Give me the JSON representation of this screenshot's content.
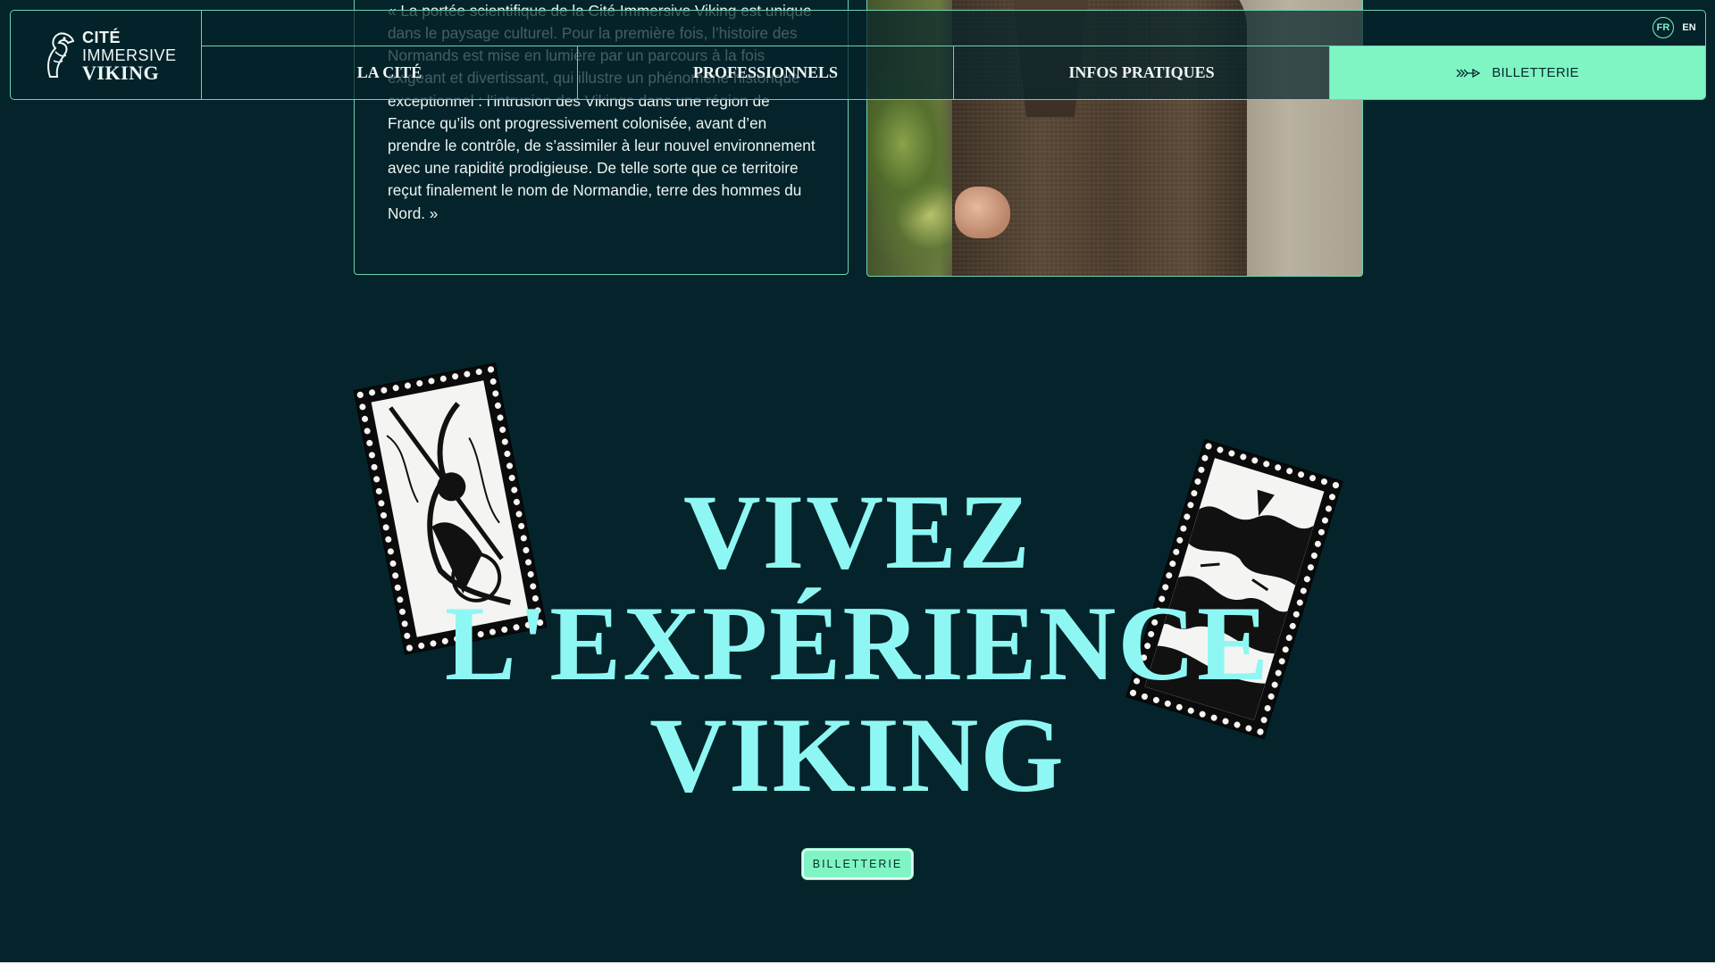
{
  "intro": {
    "quote": "« La portée scientifique de la Cité Immersive Viking est unique dans le paysage culturel. Pour la première fois, l’histoire des Normands est mise en lumière par un parcours à la fois exigeant et divertissant, qui illustre un phénomène historique exceptionnel : l’intrusion des Vikings dans une région de France qu’ils ont progressivement colonisée, avant d’en prendre le contrôle, de s’assimiler à leur nouvel environnement avec une rapidité prodigieuse. De telle sorte que ce territoire reçut finalement le nom de Normandie, terre des hommes du Nord. »"
  },
  "header": {
    "logo": {
      "line1": "CITÉ",
      "line2": "IMMERSIVE",
      "line3": "VIKING"
    },
    "languages": [
      "FR",
      "EN"
    ],
    "active_language": "FR",
    "nav": [
      "LA CITÉ",
      "PROFESSIONNELS",
      "INFOS PRATIQUES"
    ],
    "ticket_label": "BILLETTERIE"
  },
  "hero": {
    "line1": "VIVEZ",
    "line2": "L'EXPÉRIENCE",
    "line3": "VIKING",
    "button_label": "BILLETTERIE"
  },
  "colors": {
    "background": "#04232a",
    "accent": "#7ff5c4",
    "title": "#8ff7f3",
    "border": "#6fd2b0"
  }
}
